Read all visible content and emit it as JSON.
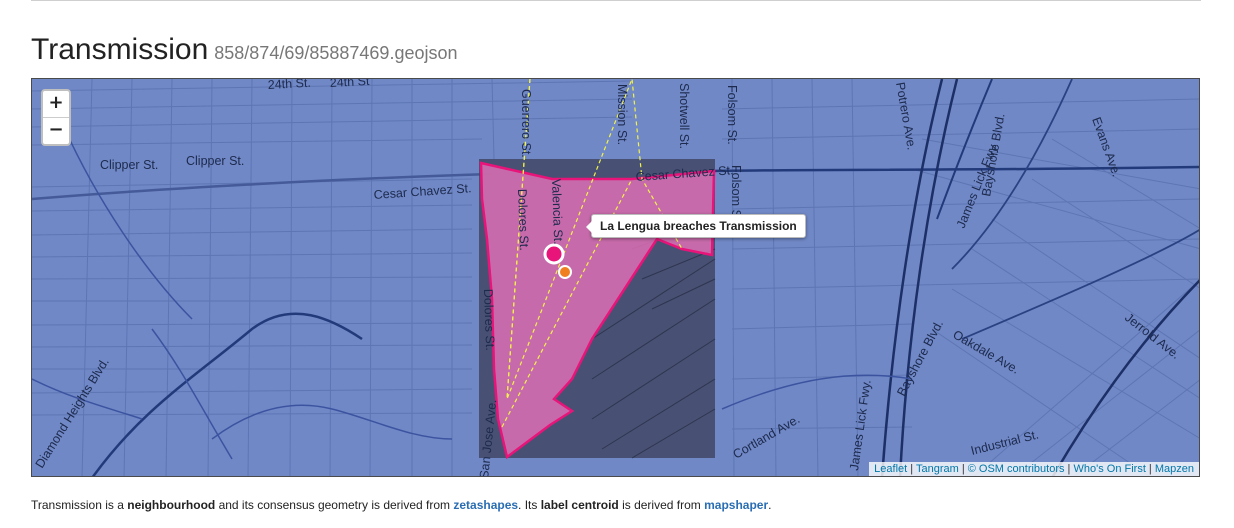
{
  "header": {
    "title": "Transmission",
    "subtitle": "858/874/69/85887469.geojson"
  },
  "map": {
    "zoom_in": "+",
    "zoom_out": "−",
    "tooltip": "La Lengua breaches Transmission",
    "street_labels": [
      "24th St.",
      "24th St",
      "Guerrero St.",
      "Valencia St.",
      "Mission St.",
      "Shotwell St.",
      "Folsom St.",
      "Folsom St.",
      "Potrero Ave.",
      "Clipper St.",
      "Clipper St.",
      "Cesar Chavez St.",
      "Cesar Chavez St.",
      "Dolores St.",
      "Dolores St.",
      "Bayshore Blvd.",
      "Bayshore Blvd.",
      "James Lick Fwy.",
      "Evans Ave.",
      "Oakdale Ave.",
      "Jerrold Ave.",
      "Industrial St.",
      "Cortland Ave.",
      "San Jose Ave.",
      "Diamond Heights Blvd.",
      "James Lick Fwy."
    ],
    "colors": {
      "map_fill": "#7088c6",
      "bbox_fill": "#3f4660",
      "polygon_fill": "#de6fb5",
      "polygon_stroke": "#e8147a",
      "dashed_line": "#f2f24a",
      "centroid_primary": "#e8147a",
      "centroid_secondary": "#f07f20"
    }
  },
  "attribution": {
    "items": [
      "Leaflet",
      "Tangram",
      "© OSM contributors",
      "Who's On First",
      "Mapzen"
    ]
  },
  "description": {
    "t1": "Transmission is a ",
    "b1": "neighbourhood",
    "t2": " and its consensus geometry is derived from ",
    "link1": "zetashapes",
    "t3": ". Its ",
    "b2": "label centroid",
    "t4": " is derived from ",
    "link2": "mapshaper",
    "t5": "."
  }
}
